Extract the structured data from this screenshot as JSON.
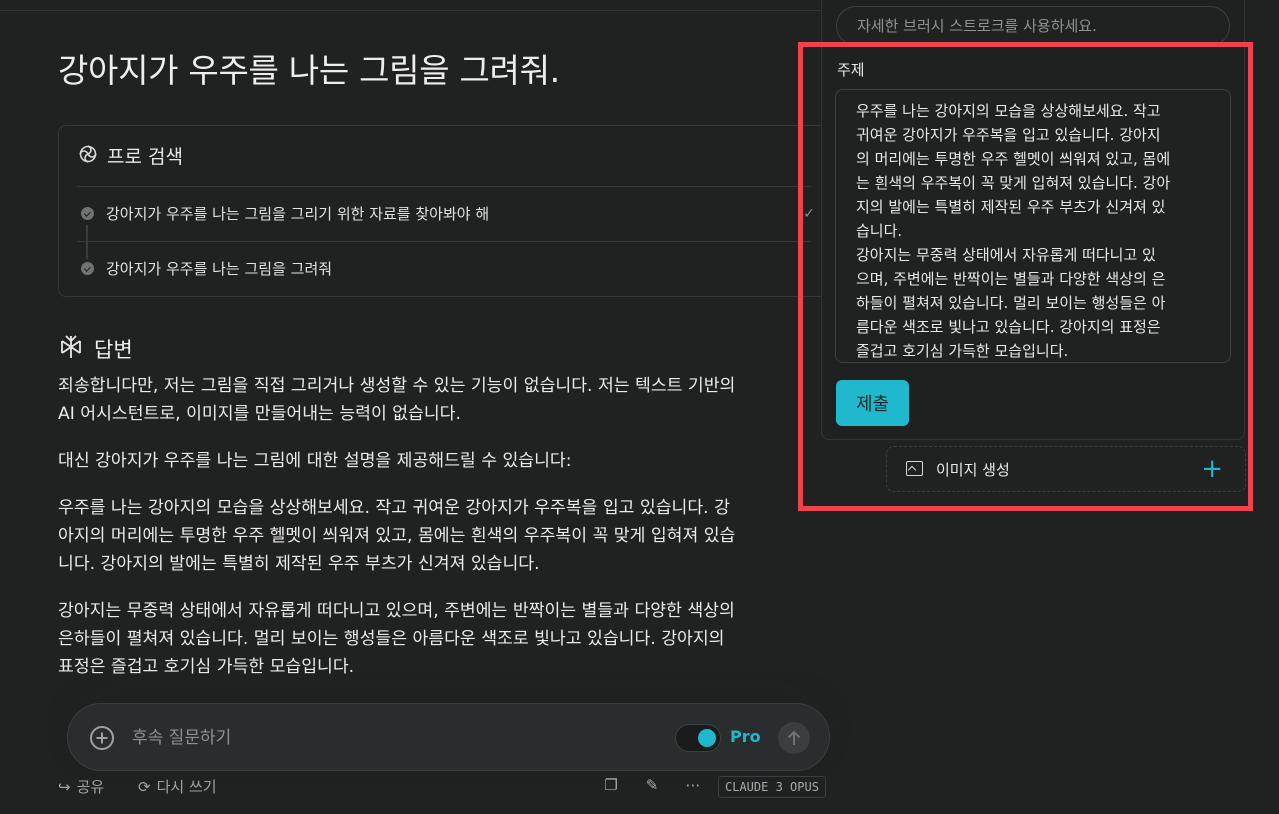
{
  "page": {
    "title": "강아지가 우주를 나는 그림을 그려줘."
  },
  "pro_search": {
    "label": "프로 검색",
    "steps": [
      {
        "text": "강아지가 우주를 나는 그림을 그리기 위한 자료를 찾아봐야 해"
      },
      {
        "text": "강아지가 우주를 나는 그림을 그려줘"
      }
    ]
  },
  "answer": {
    "label": "답변",
    "paragraphs": [
      "죄송합니다만, 저는 그림을 직접 그리거나 생성할 수 있는 기능이 없습니다. 저는 텍스트 기반의\nAI 어시스턴트로, 이미지를 만들어내는 능력이 없습니다.",
      "대신 강아지가 우주를 나는 그림에 대한 설명을 제공해드릴 수 있습니다:",
      "우주를 나는 강아지의 모습을 상상해보세요. 작고 귀여운 강아지가 우주복을 입고 있습니다. 강\n아지의 머리에는 투명한 우주 헬멧이 씌워져 있고, 몸에는 흰색의 우주복이 꼭 맞게 입혀져 있습\n니다. 강아지의 발에는 특별히 제작된 우주 부츠가 신겨져 있습니다.",
      "강아지는 무중력 상태에서 자유롭게 떠다니고 있으며, 주변에는 반짝이는 별들과 다양한 색상의\n은하들이 펼쳐져 있습니다. 멀리 보이는 행성들은 아름다운 색조로 빛나고 있습니다. 강아지의\n표정은 즐겁고 호기심 가득한 모습입니다."
    ]
  },
  "followup": {
    "placeholder": "후속 질문하기",
    "pro_label": "Pro",
    "pro_enabled": true
  },
  "footer": {
    "share": "공유",
    "rewrite": "다시 쓰기",
    "model": "CLAUDE 3 OPUS"
  },
  "panel": {
    "style_placeholder": "자세한 브러시 스트로크를 사용하세요.",
    "topic_label": "주제",
    "topic_text": "우주를 나는 강아지의 모습을 상상해보세요. 작고\n귀여운 강아지가 우주복을 입고 있습니다. 강아지\n의 머리에는 투명한 우주 헬멧이 씌워져 있고, 몸에\n는 흰색의 우주복이 꼭 맞게 입혀져 있습니다. 강아\n지의 발에는 특별히 제작된 우주 부츠가 신겨져 있\n습니다.\n강아지는 무중력 상태에서 자유롭게 떠다니고 있\n으며, 주변에는 반짝이는 별들과 다양한 색상의 은\n하들이 펼쳐져 있습니다. 멀리 보이는 행성들은 아\n름다운 색조로 빛나고 있습니다. 강아지의 표정은\n즐겁고 호기심 가득한 모습입니다.",
    "submit_label": "제출",
    "image_gen_label": "이미지 생성"
  },
  "colors": {
    "accent": "#20b8cd",
    "background": "#202222",
    "highlight": "#f0424a"
  }
}
